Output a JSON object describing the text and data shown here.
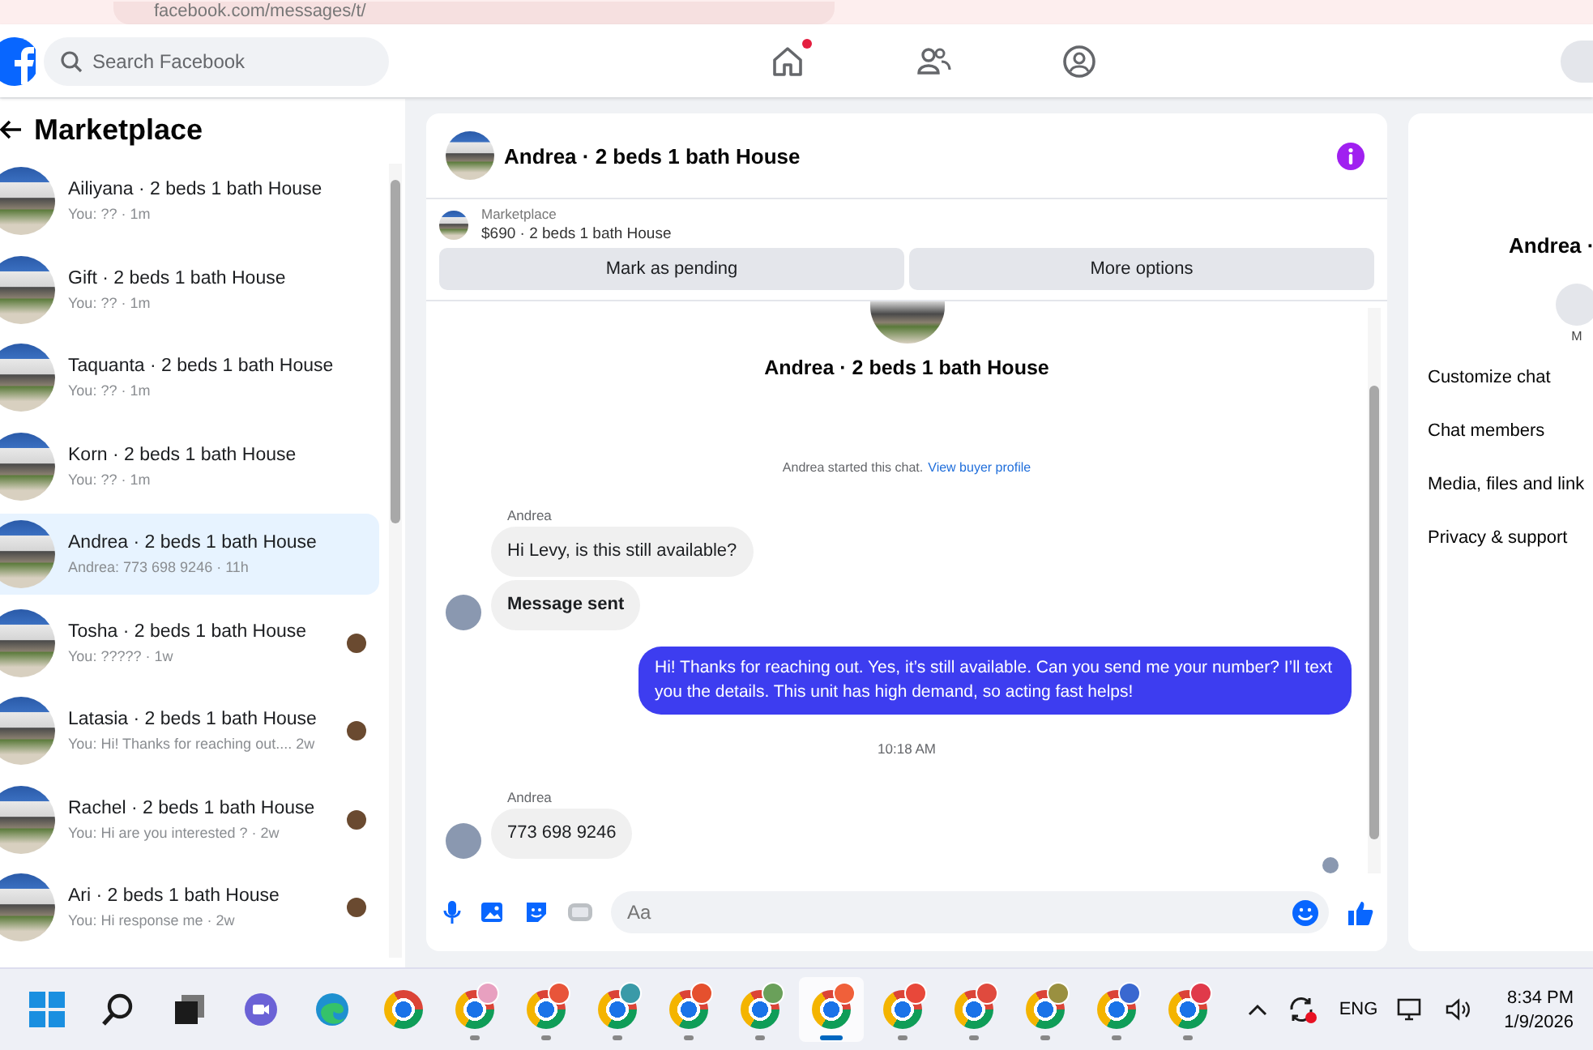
{
  "browser": {
    "address": "facebook.com/messages/t/"
  },
  "header": {
    "search": {
      "placeholder": "Search Facebook"
    },
    "nav": [
      {
        "kind": "home",
        "notification": true
      },
      {
        "kind": "friends",
        "notification": false
      },
      {
        "kind": "groups",
        "notification": false
      }
    ]
  },
  "sidebar": {
    "title": "Marketplace",
    "chats": [
      {
        "title": "Ailiyana · 2 beds 1 bath House",
        "preview": "You: ?? · 1m",
        "selected": false,
        "seen": false
      },
      {
        "title": "Gift · 2 beds 1 bath House",
        "preview": "You: ?? · 1m",
        "selected": false,
        "seen": false
      },
      {
        "title": "Taquanta · 2 beds 1 bath House",
        "preview": "You: ?? · 1m",
        "selected": false,
        "seen": false
      },
      {
        "title": "Korn · 2 beds 1 bath House",
        "preview": "You: ?? · 1m",
        "selected": false,
        "seen": false
      },
      {
        "title": "Andrea · 2 beds 1 bath House",
        "preview": "Andrea: 773 698 9246 · 11h",
        "selected": true,
        "seen": false
      },
      {
        "title": "Tosha · 2 beds 1 bath House",
        "preview": "You: ????? · 1w",
        "selected": false,
        "seen": true
      },
      {
        "title": "Latasia · 2 beds 1 bath House",
        "preview": "You: Hi! Thanks for reaching out.... 2w",
        "selected": false,
        "seen": true
      },
      {
        "title": "Rachel · 2 beds 1 bath House",
        "preview": "You: Hi are you interested ? · 2w",
        "selected": false,
        "seen": true
      },
      {
        "title": "Ari · 2 beds 1 bath House",
        "preview": "You: Hi response me · 2w",
        "selected": false,
        "seen": true
      }
    ]
  },
  "chat": {
    "title": "Andrea · 2 beds 1 bath House",
    "listing": {
      "label": "Marketplace",
      "summary": "$690 · 2 beds 1 bath House"
    },
    "buttons": [
      "Mark as pending",
      "More options"
    ],
    "intro_title": "Andrea · 2 beds 1 bath House",
    "started": {
      "text": "Andrea started this chat.",
      "link": "View buyer profile"
    },
    "messages": [
      {
        "kind": "sender",
        "text": "Andrea"
      },
      {
        "kind": "incoming",
        "text": "Hi Levy, is this still available?",
        "avatar": false,
        "bold": false
      },
      {
        "kind": "incoming",
        "text": "Message sent",
        "avatar": true,
        "bold": true
      },
      {
        "kind": "outgoing",
        "text": "Hi! Thanks for reaching out. Yes, it’s still available. Can you send me your number? I’ll text you the details. This unit has high demand, so acting fast helps!"
      },
      {
        "kind": "time",
        "text": "10:18 AM"
      },
      {
        "kind": "sender",
        "text": "Andrea"
      },
      {
        "kind": "incoming",
        "text": "773 698 9246",
        "avatar": true,
        "bold": false
      }
    ],
    "read_receipt": true,
    "composer": {
      "placeholder": "Aa"
    }
  },
  "details": {
    "title": "Andrea ·",
    "action": "M",
    "items": [
      "Customize chat",
      "Chat members",
      "Media, files and link",
      "Privacy & support"
    ]
  },
  "taskbar": {
    "apps": [
      {
        "kind": "start",
        "selected": false,
        "running": false
      },
      {
        "kind": "search",
        "selected": false,
        "running": false
      },
      {
        "kind": "taskview",
        "selected": false,
        "running": false
      },
      {
        "kind": "meet",
        "selected": false,
        "running": false
      },
      {
        "kind": "edge",
        "selected": false,
        "running": false
      },
      {
        "kind": "chrome",
        "selected": false,
        "running": false
      },
      {
        "kind": "profile",
        "color": "#e8a0c0",
        "selected": false,
        "running": true
      },
      {
        "kind": "profile",
        "color": "#e8553a",
        "selected": false,
        "running": true
      },
      {
        "kind": "profile",
        "color": "#3a9aa8",
        "selected": false,
        "running": true
      },
      {
        "kind": "profile",
        "color": "#e5502e",
        "selected": false,
        "running": true
      },
      {
        "kind": "profile",
        "color": "#6aa05a",
        "selected": false,
        "running": true
      },
      {
        "kind": "profile",
        "color": "#f0603a",
        "selected": true,
        "running": true
      },
      {
        "kind": "profile",
        "color": "#e8483a",
        "selected": false,
        "running": true
      },
      {
        "kind": "profile",
        "color": "#e04a3e",
        "selected": false,
        "running": true
      },
      {
        "kind": "profile",
        "color": "#9a9040",
        "selected": false,
        "running": true
      },
      {
        "kind": "profile",
        "color": "#3a68d0",
        "selected": false,
        "running": true
      },
      {
        "kind": "profile",
        "color": "#e03a4a",
        "selected": false,
        "running": true
      }
    ],
    "language": "ENG",
    "time": "8:34 PM",
    "date": "1/9/2026"
  }
}
